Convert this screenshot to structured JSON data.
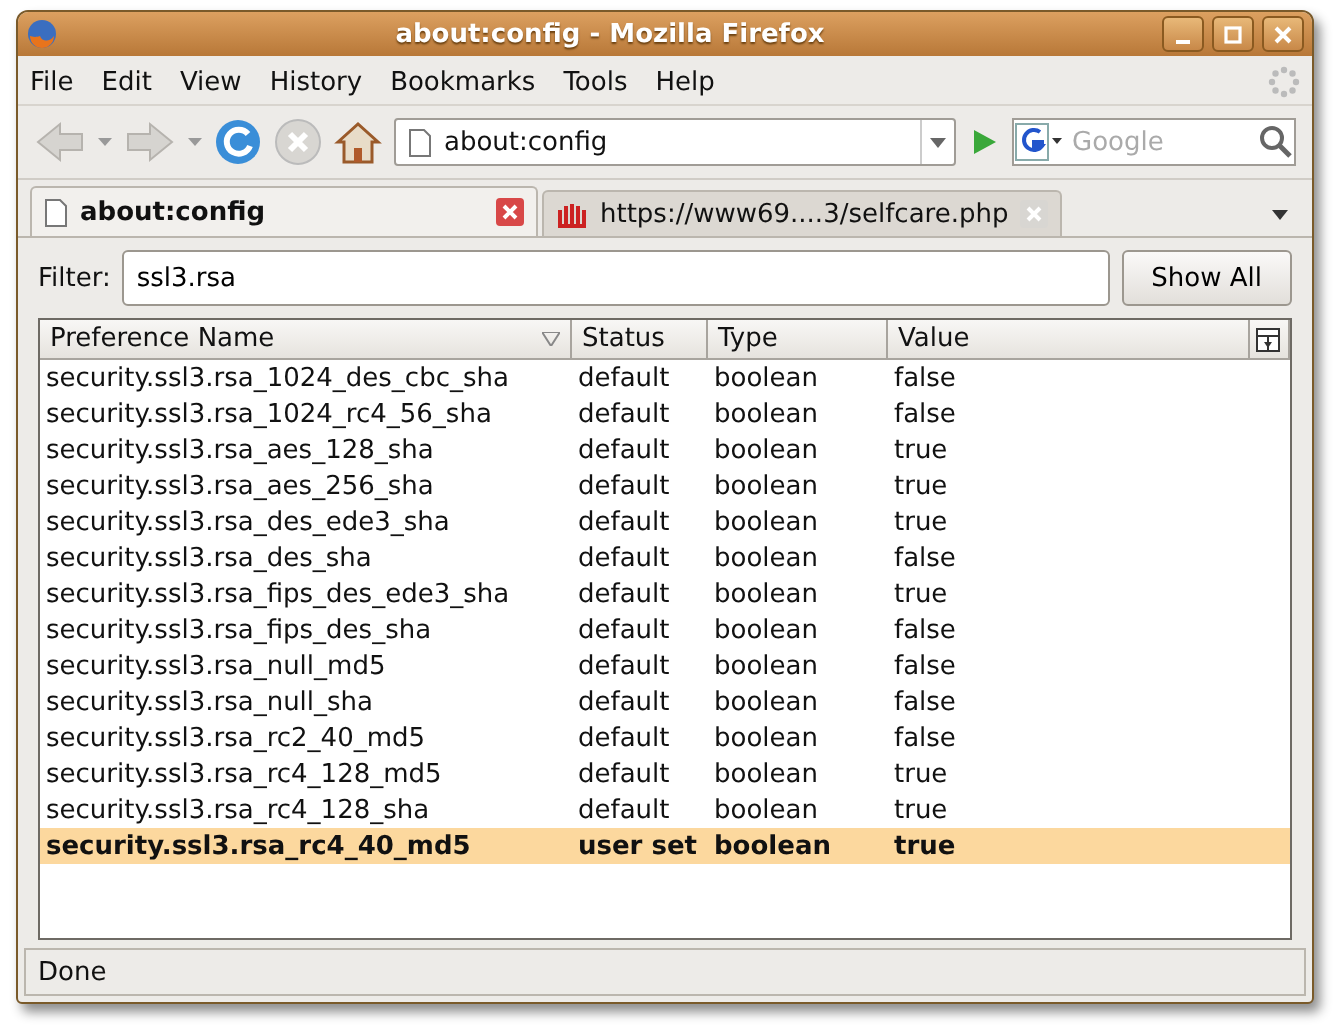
{
  "window": {
    "title": "about:config - Mozilla Firefox"
  },
  "menu": [
    "File",
    "Edit",
    "View",
    "History",
    "Bookmarks",
    "Tools",
    "Help"
  ],
  "toolbar": {
    "url": "about:config",
    "search_placeholder": "Google"
  },
  "tabs": [
    {
      "label": "about:config",
      "selected": true
    },
    {
      "label": "https://www69....3/selfcare.php",
      "selected": false
    }
  ],
  "filter": {
    "label": "Filter:",
    "value": "ssl3.rsa",
    "button": "Show All"
  },
  "table": {
    "columns": [
      "Preference Name",
      "Status",
      "Type",
      "Value"
    ],
    "rows": [
      {
        "name": "security.ssl3.rsa_1024_des_cbc_sha",
        "status": "default",
        "type": "boolean",
        "value": "false",
        "modified": false,
        "selected": false
      },
      {
        "name": "security.ssl3.rsa_1024_rc4_56_sha",
        "status": "default",
        "type": "boolean",
        "value": "false",
        "modified": false,
        "selected": false
      },
      {
        "name": "security.ssl3.rsa_aes_128_sha",
        "status": "default",
        "type": "boolean",
        "value": "true",
        "modified": false,
        "selected": false
      },
      {
        "name": "security.ssl3.rsa_aes_256_sha",
        "status": "default",
        "type": "boolean",
        "value": "true",
        "modified": false,
        "selected": false
      },
      {
        "name": "security.ssl3.rsa_des_ede3_sha",
        "status": "default",
        "type": "boolean",
        "value": "true",
        "modified": false,
        "selected": false
      },
      {
        "name": "security.ssl3.rsa_des_sha",
        "status": "default",
        "type": "boolean",
        "value": "false",
        "modified": false,
        "selected": false
      },
      {
        "name": "security.ssl3.rsa_fips_des_ede3_sha",
        "status": "default",
        "type": "boolean",
        "value": "true",
        "modified": false,
        "selected": false
      },
      {
        "name": "security.ssl3.rsa_fips_des_sha",
        "status": "default",
        "type": "boolean",
        "value": "false",
        "modified": false,
        "selected": false
      },
      {
        "name": "security.ssl3.rsa_null_md5",
        "status": "default",
        "type": "boolean",
        "value": "false",
        "modified": false,
        "selected": false
      },
      {
        "name": "security.ssl3.rsa_null_sha",
        "status": "default",
        "type": "boolean",
        "value": "false",
        "modified": false,
        "selected": false
      },
      {
        "name": "security.ssl3.rsa_rc2_40_md5",
        "status": "default",
        "type": "boolean",
        "value": "false",
        "modified": false,
        "selected": false
      },
      {
        "name": "security.ssl3.rsa_rc4_128_md5",
        "status": "default",
        "type": "boolean",
        "value": "true",
        "modified": false,
        "selected": false
      },
      {
        "name": "security.ssl3.rsa_rc4_128_sha",
        "status": "default",
        "type": "boolean",
        "value": "true",
        "modified": false,
        "selected": false
      },
      {
        "name": "security.ssl3.rsa_rc4_40_md5",
        "status": "user set",
        "type": "boolean",
        "value": "true",
        "modified": true,
        "selected": true
      }
    ]
  },
  "status_bar": "Done"
}
